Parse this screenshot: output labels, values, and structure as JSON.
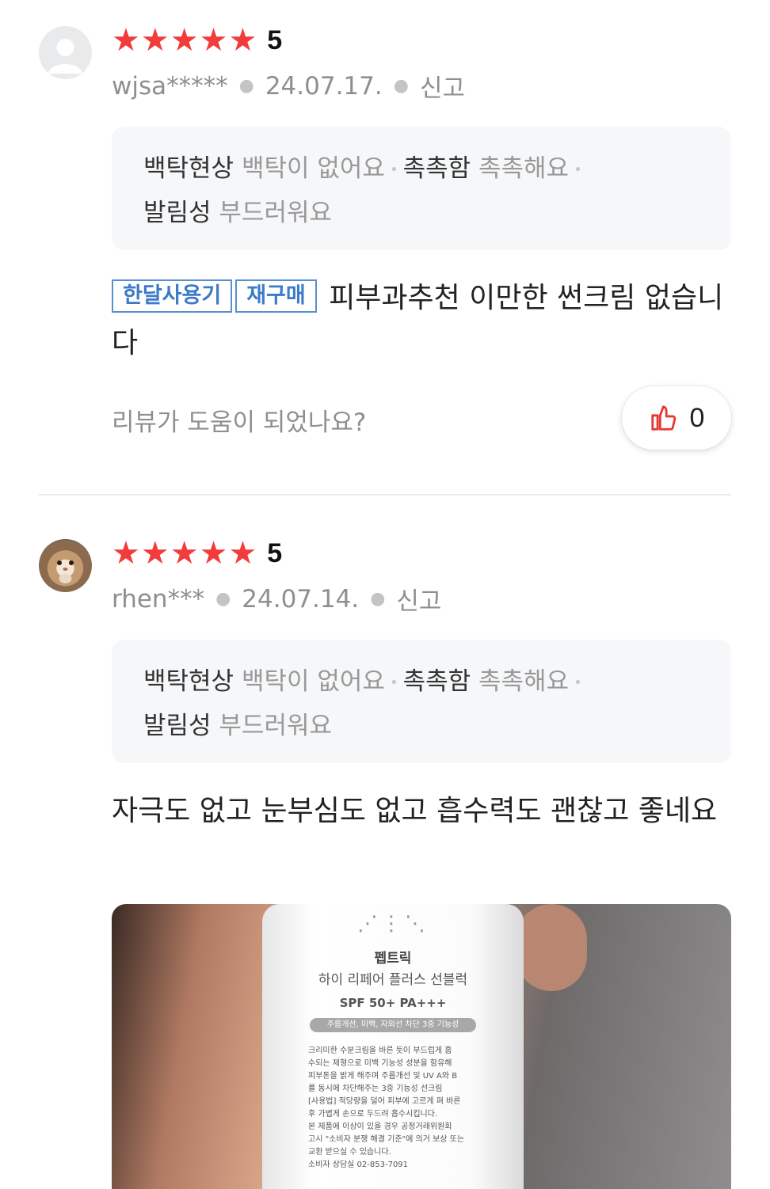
{
  "reviews": [
    {
      "rating": "5",
      "stars": 5,
      "user": "wjsa*****",
      "date": "24.07.17.",
      "report": "신고",
      "attributes": [
        {
          "key": "백탁현상",
          "value": "백탁이 없어요"
        },
        {
          "key": "촉촉함",
          "value": "촉촉해요"
        },
        {
          "key": "발림성",
          "value": "부드러워요"
        }
      ],
      "tags": [
        "한달사용기",
        "재구매"
      ],
      "text": "피부과추천 이만한 썬크림 없습니다",
      "helpful_question": "리뷰가 도움이 되었나요?",
      "likes": "0"
    },
    {
      "rating": "5",
      "stars": 5,
      "user": "rhen***",
      "date": "24.07.14.",
      "report": "신고",
      "attributes": [
        {
          "key": "백탁현상",
          "value": "백탁이 없어요"
        },
        {
          "key": "촉촉함",
          "value": "촉촉해요"
        },
        {
          "key": "발림성",
          "value": "부드러워요"
        }
      ],
      "text": "자극도 없고 눈부심도 없고 흡수력도 괜찮고 좋네요",
      "photo": {
        "brand": "펩트릭",
        "product": "하이 리페어 플러스 선블럭",
        "spf": "SPF 50+ PA+++",
        "band": "주름개선, 미백, 자외선 차단 3중 기능성",
        "description": "크리미한 수분크림을 바른 듯이 부드럽게 흡\n수되는 제형으로 미백 기능성 성분을 함유해\n피부톤을 밝게 해주며 주름개선 및 UV A와 B\n를 동시에 차단해주는 3중 기능성 선크림\n[사용법] 적당량을 덜어 피부에 고르게 펴 바른\n후 가볍게 손으로 두드려 흡수시킵니다.\n본 제품에 이상이 있을 경우 공정거래위원회\n고시 \"소비자 분쟁 해결 기준\"에 의거 보상 또는\n교환 받으실 수 있습니다.\n소비자 상담실 02-853-7091"
      }
    }
  ],
  "colors": {
    "star": "#f23b3b",
    "tag_border": "#5a90d0",
    "like_icon": "#e53935"
  },
  "icons": {
    "like": "thumbs-up-icon",
    "avatar_default": "user-silhouette-icon"
  }
}
